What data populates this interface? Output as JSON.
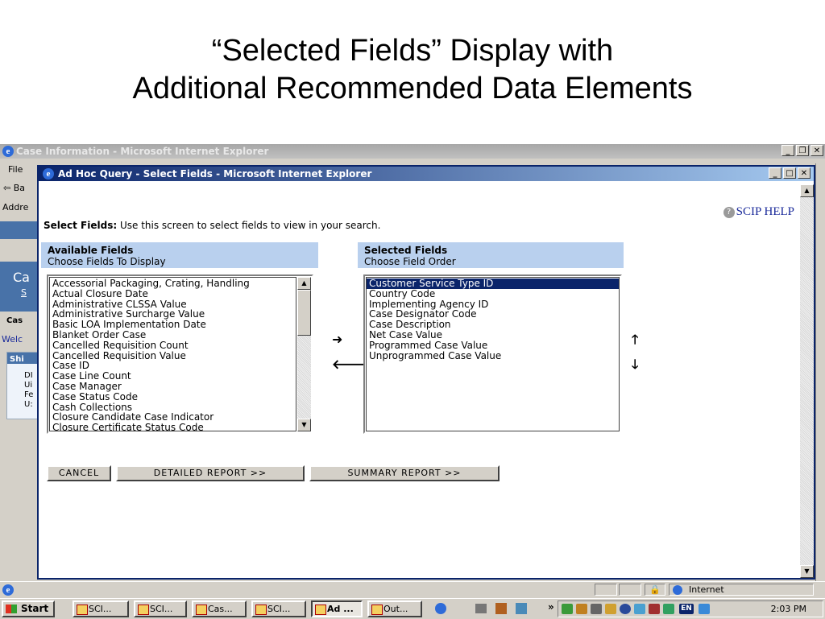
{
  "slide": {
    "title_line1": "“Selected Fields” Display with",
    "title_line2": "Additional Recommended Data Elements"
  },
  "outer_window": {
    "title": "Case Information - Microsoft Internet Explorer",
    "menu_file": "File",
    "toolbar_back": "⇦ Ba",
    "address_label": "Addre",
    "left_fragments": [
      "Ca",
      "S",
      "Cas",
      "Welc",
      "Shi",
      "DI",
      "Ui",
      "Fe",
      "U:"
    ]
  },
  "inner_window": {
    "title": "Ad Hoc Query - Select Fields - Microsoft Internet Explorer",
    "help_label": "SCIP HELP",
    "instruction_bold": "Select Fields:",
    "instruction_text": " Use this screen to select fields to view in your search.",
    "available": {
      "heading": "Available Fields",
      "subheading": "Choose Fields To Display",
      "items": [
        "Accessorial Packaging, Crating, Handling",
        "Actual Closure Date",
        "Administrative CLSSA Value",
        "Administrative Surcharge Value",
        "Basic LOA Implementation Date",
        "Blanket Order Case",
        "Cancelled Requisition Count",
        "Cancelled Requisition Value",
        "Case ID",
        "Case Line Count",
        "Case Manager",
        "Case Status Code",
        "Cash Collections",
        "Closure Candidate Case Indicator",
        "Closure Certificate Status Code"
      ]
    },
    "selected": {
      "heading": "Selected Fields",
      "subheading": "Choose Field Order",
      "selected_index": 0,
      "items": [
        "Customer Service Type ID",
        "Country Code",
        "Implementing Agency ID",
        "Case Designator Code",
        "Case Description",
        "Net Case Value",
        "Programmed Case Value",
        "Unprogrammed Case Value"
      ]
    },
    "arrows": {
      "add": "➜",
      "remove": "🡐",
      "up": "🡑",
      "down": "🡓"
    },
    "buttons": {
      "cancel": "CANCEL",
      "detailed": "DETAILED REPORT >>",
      "summary": "SUMMARY REPORT >>"
    }
  },
  "statusbar": {
    "zone": "Internet"
  },
  "taskbar": {
    "start": "Start",
    "tasks": [
      "SCI...",
      "SCI...",
      "Cas...",
      "SCI...",
      "Ad ...",
      "Out..."
    ],
    "active_task_index": 4,
    "overflow": "»",
    "lang": "EN",
    "clock": "2:03 PM"
  },
  "colors": {
    "title_bar_active": "#0a246a",
    "panel_header": "#b9d0ee",
    "selection": "#0a246a",
    "help_link": "#1a2a9a"
  }
}
